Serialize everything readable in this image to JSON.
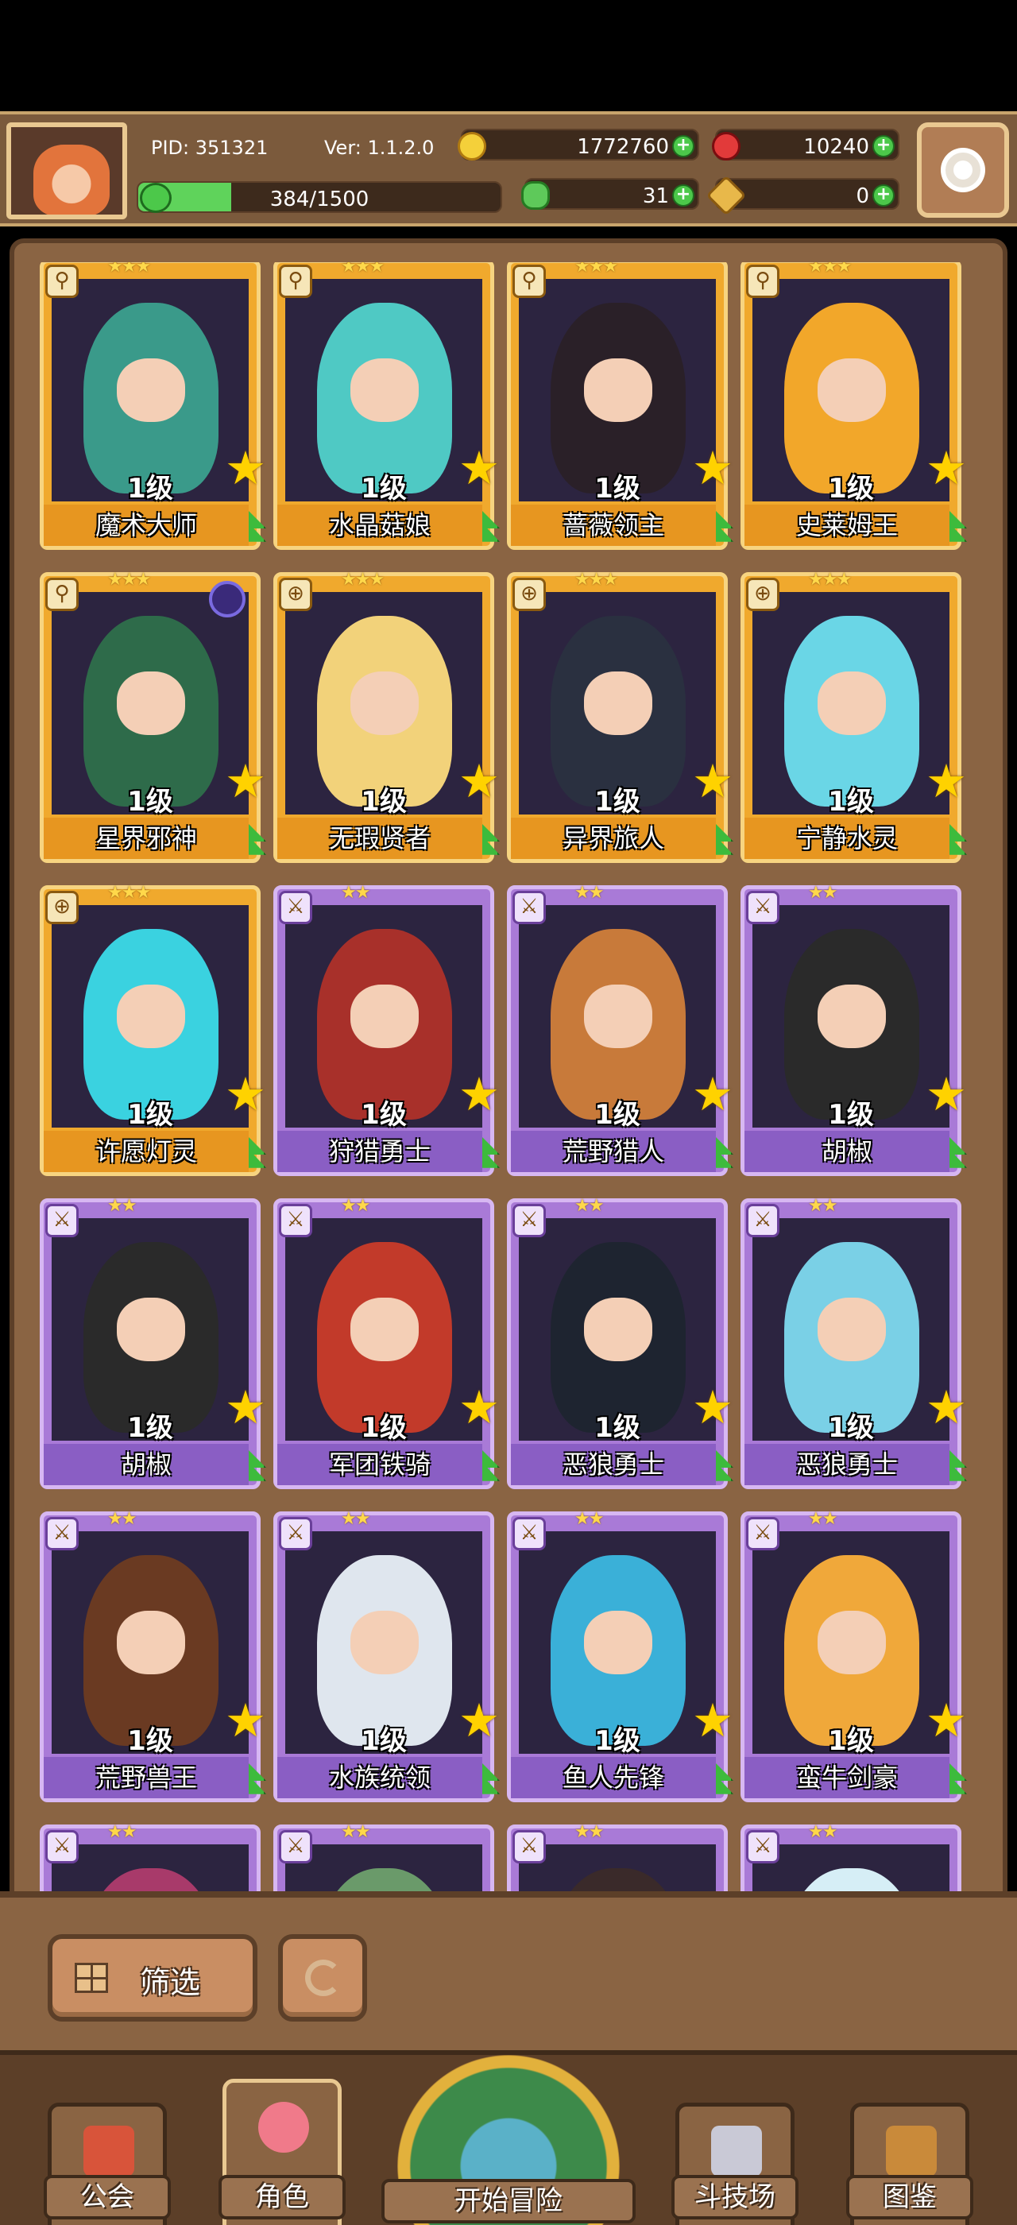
{
  "header": {
    "pid": "PID: 351321",
    "version": "Ver: 1.1.2.0",
    "gold": "1772760",
    "gems": "10240",
    "xp_text": "384/1500",
    "xp_fraction": 0.256,
    "clover": "31",
    "keys": "0"
  },
  "cards": [
    {
      "name": "魔术大师",
      "level": "1级",
      "stars": "★★★",
      "rarity": "gold",
      "type_icon": "wrench-icon",
      "color": "#3a9a8a"
    },
    {
      "name": "水晶菇娘",
      "level": "1级",
      "stars": "★★★",
      "rarity": "gold",
      "type_icon": "wrench-icon",
      "color": "#4fc9c4"
    },
    {
      "name": "蔷薇领主",
      "level": "1级",
      "stars": "★★★",
      "rarity": "gold",
      "type_icon": "wrench-icon",
      "color": "#2a2028"
    },
    {
      "name": "史莱姆王",
      "level": "1级",
      "stars": "★★★",
      "rarity": "gold",
      "type_icon": "wrench-icon",
      "color": "#f2a72a"
    },
    {
      "name": "星界邪神",
      "level": "1级",
      "stars": "★★★",
      "rarity": "gold",
      "type_icon": "wrench-icon",
      "color": "#2e6b4a"
    },
    {
      "name": "无瑕贤者",
      "level": "1级",
      "stars": "★★★",
      "rarity": "gold",
      "type_icon": "shield-icon",
      "color": "#f2d27a"
    },
    {
      "name": "异界旅人",
      "level": "1级",
      "stars": "★★★",
      "rarity": "gold",
      "type_icon": "shield-icon",
      "color": "#2a3040"
    },
    {
      "name": "宁静水灵",
      "level": "1级",
      "stars": "★★★",
      "rarity": "gold",
      "type_icon": "shield-icon",
      "color": "#6ad6e6"
    },
    {
      "name": "许愿灯灵",
      "level": "1级",
      "stars": "★★★",
      "rarity": "gold",
      "type_icon": "shield-icon",
      "color": "#3ad2e0"
    },
    {
      "name": "狩猎勇士",
      "level": "1级",
      "stars": "★★",
      "rarity": "purple",
      "type_icon": "sword-icon",
      "color": "#a8302a"
    },
    {
      "name": "荒野猎人",
      "level": "1级",
      "stars": "★★",
      "rarity": "purple",
      "type_icon": "sword-icon",
      "color": "#c87a3a"
    },
    {
      "name": "胡椒",
      "level": "1级",
      "stars": "★★",
      "rarity": "purple",
      "type_icon": "sword-icon",
      "color": "#2a2a2a"
    },
    {
      "name": "胡椒",
      "level": "1级",
      "stars": "★★",
      "rarity": "purple",
      "type_icon": "sword-icon",
      "color": "#2a2a2a"
    },
    {
      "name": "军团铁骑",
      "level": "1级",
      "stars": "★★",
      "rarity": "purple",
      "type_icon": "sword-icon",
      "color": "#c23a2a"
    },
    {
      "name": "恶狼勇士",
      "level": "1级",
      "stars": "★★",
      "rarity": "purple",
      "type_icon": "sword-icon",
      "color": "#1e2430"
    },
    {
      "name": "恶狼勇士",
      "level": "1级",
      "stars": "★★",
      "rarity": "purple",
      "type_icon": "sword-icon",
      "color": "#7ad0e6"
    },
    {
      "name": "荒野兽王",
      "level": "1级",
      "stars": "★★",
      "rarity": "purple",
      "type_icon": "sword-icon",
      "color": "#6a3a22"
    },
    {
      "name": "水族统领",
      "level": "1级",
      "stars": "★★",
      "rarity": "purple",
      "type_icon": "sword-icon",
      "color": "#dfe6ee"
    },
    {
      "name": "鱼人先锋",
      "level": "1级",
      "stars": "★★",
      "rarity": "purple",
      "type_icon": "sword-icon",
      "color": "#3ab0d8"
    },
    {
      "name": "蛮牛剑豪",
      "level": "1级",
      "stars": "★★",
      "rarity": "purple",
      "type_icon": "sword-icon",
      "color": "#f0a83a"
    },
    {
      "name": "",
      "level": "",
      "stars": "★★",
      "rarity": "purple",
      "type_icon": "sword-icon",
      "color": "#a83a6a"
    },
    {
      "name": "",
      "level": "",
      "stars": "★★",
      "rarity": "purple",
      "type_icon": "sword-icon",
      "color": "#6a9a6a"
    },
    {
      "name": "",
      "level": "",
      "stars": "★★",
      "rarity": "purple",
      "type_icon": "sword-icon",
      "color": "#3a2a2a"
    },
    {
      "name": "",
      "level": "",
      "stars": "★★",
      "rarity": "purple",
      "type_icon": "sword-icon",
      "color": "#d6eef6"
    }
  ],
  "controls": {
    "filter_label": "筛选"
  },
  "nav": {
    "guild": "公会",
    "characters": "角色",
    "adventure": "开始冒险",
    "arena": "斗技场",
    "codex": "图鉴"
  }
}
